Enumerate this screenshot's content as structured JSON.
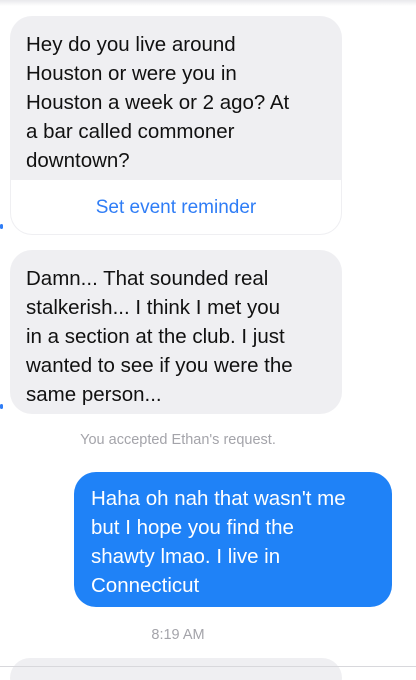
{
  "conversation": {
    "messages": [
      {
        "direction": "incoming",
        "text": "Hey do you live around\nHouston or were you in\nHouston a week or 2 ago? At\na bar called commoner\ndowntown?",
        "action_label": "Set event reminder"
      },
      {
        "direction": "incoming",
        "text": "Damn... That sounded real\nstalkerish... I think I met you\nin a section at the club. I just\nwanted to see if you were the\nsame person..."
      },
      {
        "direction": "outgoing",
        "text": "Haha oh nah that wasn't me\nbut I hope you find the\nshawty lmao. I live in\nConnecticut"
      }
    ],
    "status_text": "You accepted Ethan's request.",
    "timestamp": "8:19 AM"
  },
  "colors": {
    "incoming_bubble": "#efeff2",
    "outgoing_bubble": "#1f82f7",
    "accent": "#2f7df6",
    "meta_text": "#a4a4aa"
  }
}
